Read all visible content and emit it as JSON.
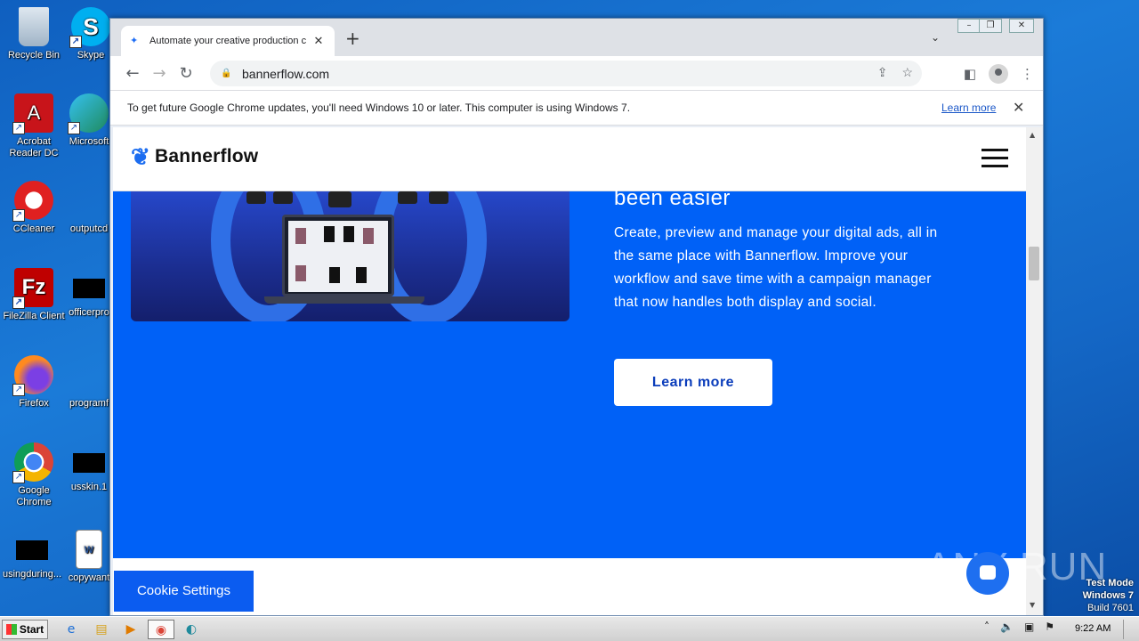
{
  "desktop": {
    "icons": [
      {
        "label": "Recycle Bin"
      },
      {
        "label": "Skype"
      },
      {
        "label": "Acrobat Reader DC"
      },
      {
        "label": "Microsoft"
      },
      {
        "label": "CCleaner"
      },
      {
        "label": "outputcd"
      },
      {
        "label": "FileZilla Client"
      },
      {
        "label": "officerpro"
      },
      {
        "label": "Firefox"
      },
      {
        "label": "programf"
      },
      {
        "label": "Google Chrome"
      },
      {
        "label": "usskin.1"
      },
      {
        "label": "usingduring..."
      },
      {
        "label": "copywant"
      }
    ]
  },
  "browser": {
    "tab_title": "Automate your creative production c",
    "url": "bannerflow.com",
    "infobar_text": "To get future Google Chrome updates, you'll need Windows 10 or later. This computer is using Windows 7.",
    "infobar_link": "Learn more"
  },
  "site": {
    "logo_text": "Bannerflow",
    "hero_heading": "been easier",
    "hero_paragraph": "Create, preview and manage your digital ads, all in the same place with Bannerflow. Improve your workflow and save time with a campaign manager that now handles both display and social.",
    "learn_more": "Learn more",
    "cookie_settings": "Cookie Settings"
  },
  "watermark": "ANY RUN",
  "test_mode": {
    "line1": "Test Mode",
    "line2": "Windows 7",
    "line3": "Build 7601"
  },
  "taskbar": {
    "start": "Start",
    "clock": "9:22 AM"
  },
  "colors": {
    "accent": "#0061f7",
    "brand": "#1c6df0"
  }
}
